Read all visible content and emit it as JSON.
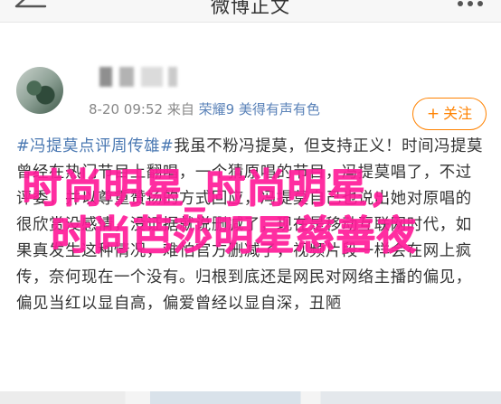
{
  "nav": {
    "title": "微博正文",
    "back_icon": "arrow-left-icon",
    "more_icon": "more-dots-icon"
  },
  "post": {
    "time": "8-20 09:52",
    "source_prefix": "来自",
    "source": "荣耀9 美得有声有色",
    "follow_label": "关注",
    "follow_plus": "+",
    "hashtag": "#冯提莫点评周传雄#",
    "text": "我虽不粉冯提莫，但支持正义！时间冯提莫曾经在热门节目上翻唱，一个猜原唱的节目，冯提莫唱了，不过评委，并以尊重赞扬的方式回应，冯提莫自己也说出她对原唱的很欣赏没感情，没证据就说删减了，现在是移动互联网时代，如果真发生这种情况，难怕官方删减了，视频片段一样会在网上疯传，奈何现在一个没有。归根到底还是网民对网络主播的偏见，偏见当红以显自高，偏爱曾经以显自深，丑陋"
  },
  "watermark": {
    "line1": "时尚明星_时尚明星，",
    "line2": "时尚芭莎明星慈善夜"
  },
  "colors": {
    "accent_orange": "#ff8200",
    "link_blue": "#4a78b2",
    "watermark_pink": "#ff1d9a"
  }
}
